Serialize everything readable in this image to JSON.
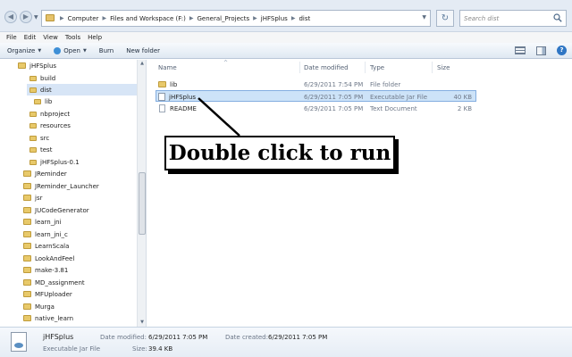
{
  "address": {
    "crumbs": [
      "Computer",
      "Files and Workspace (F:)",
      "General_Projects",
      "jHFSplus",
      "dist"
    ],
    "search_placeholder": "Search dist"
  },
  "menu": [
    "File",
    "Edit",
    "View",
    "Tools",
    "Help"
  ],
  "toolbar": {
    "organize": "Organize",
    "open": "Open",
    "burn": "Burn",
    "new_folder": "New folder"
  },
  "nav": {
    "items": [
      {
        "label": "jHFSplus",
        "depth": 0
      },
      {
        "label": "build",
        "depth": 1
      },
      {
        "label": "dist",
        "depth": 1,
        "selected": true
      },
      {
        "label": "lib",
        "depth": 2
      },
      {
        "label": "nbproject",
        "depth": 1
      },
      {
        "label": "resources",
        "depth": 1
      },
      {
        "label": "src",
        "depth": 1
      },
      {
        "label": "test",
        "depth": 1
      },
      {
        "label": "jHFSplus-0.1",
        "depth": 1
      },
      {
        "label": "JReminder",
        "depth": 0
      },
      {
        "label": "JReminder_Launcher",
        "depth": 0
      },
      {
        "label": "jsr",
        "depth": 0
      },
      {
        "label": "JUCodeGenerator",
        "depth": 0
      },
      {
        "label": "learn_jni",
        "depth": 0
      },
      {
        "label": "learn_jni_c",
        "depth": 0
      },
      {
        "label": "LearnScala",
        "depth": 0
      },
      {
        "label": "LookAndFeel",
        "depth": 0
      },
      {
        "label": "make-3.81",
        "depth": 0
      },
      {
        "label": "MD_assignment",
        "depth": 0
      },
      {
        "label": "MFUploader",
        "depth": 0
      },
      {
        "label": "Murga",
        "depth": 0
      },
      {
        "label": "native_learn",
        "depth": 0
      }
    ]
  },
  "columns": {
    "name": "Name",
    "date": "Date modified",
    "type": "Type",
    "size": "Size"
  },
  "files": [
    {
      "name": "lib",
      "date": "6/29/2011 7:54 PM",
      "type": "File folder",
      "size": "",
      "icon": "folder-icon"
    },
    {
      "name": "jHFSplus",
      "date": "6/29/2011 7:05 PM",
      "type": "Executable Jar File",
      "size": "40 KB",
      "icon": "jar-file-icon",
      "selected": true
    },
    {
      "name": "README",
      "date": "6/29/2011 7:05 PM",
      "type": "Text Document",
      "size": "2 KB",
      "icon": "text-document-icon"
    }
  ],
  "annotation": {
    "text": "Double click to run"
  },
  "details": {
    "name": "jHFSplus",
    "type": "Executable Jar File",
    "modified_label": "Date modified:",
    "modified_value": "6/29/2011 7:05 PM",
    "created_label": "Date created:",
    "created_value": "6/29/2011 7:05 PM",
    "size_label": "Size:",
    "size_value": "39.4 KB"
  },
  "colors": {
    "selection": "#cde3f8",
    "folder": "#e8c96a",
    "accent": "#2f76c4"
  }
}
